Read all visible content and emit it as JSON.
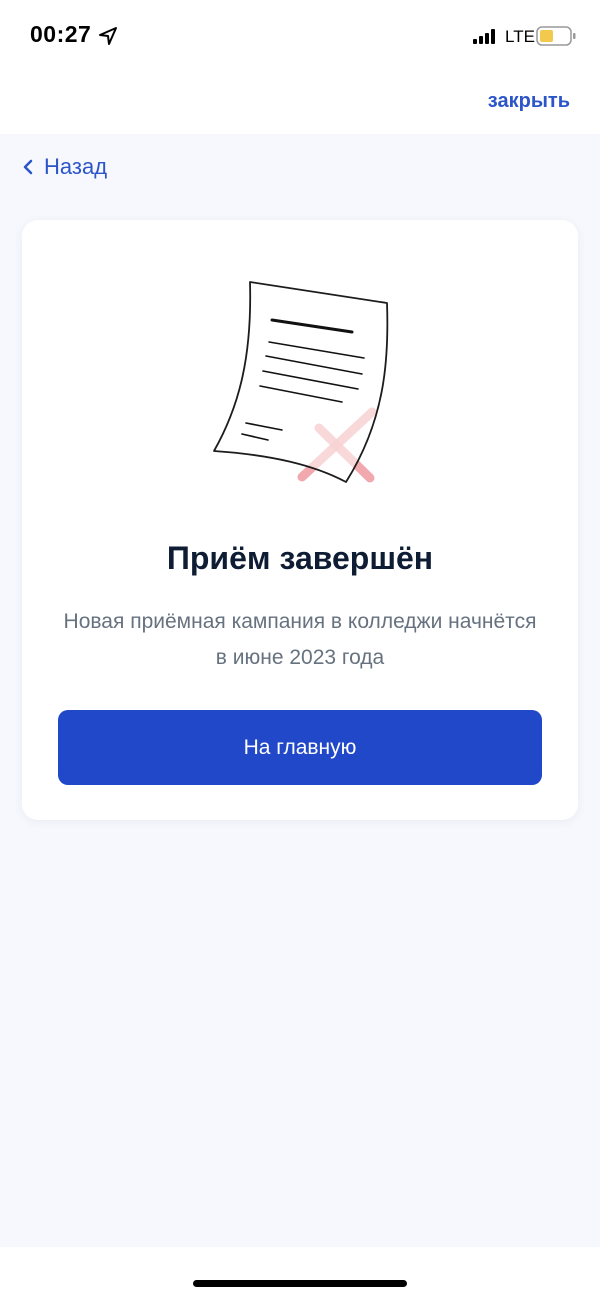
{
  "status_bar": {
    "time": "00:27",
    "network": "LTE"
  },
  "header": {
    "close_label": "закрыть"
  },
  "navigation": {
    "back_label": "Назад"
  },
  "card": {
    "title": "Приём завершён",
    "description": "Новая приёмная кампания в колледжи начнётся в июне 2023 года",
    "button_label": "На главную"
  },
  "colors": {
    "accent": "#2b55c9",
    "button": "#2148c8",
    "background": "#f6f8fd",
    "title": "#0f1d34",
    "description": "#66727f"
  },
  "icons": [
    "location-arrow-icon",
    "signal-icon",
    "battery-icon",
    "chevron-left-icon",
    "document-cancelled-icon"
  ]
}
